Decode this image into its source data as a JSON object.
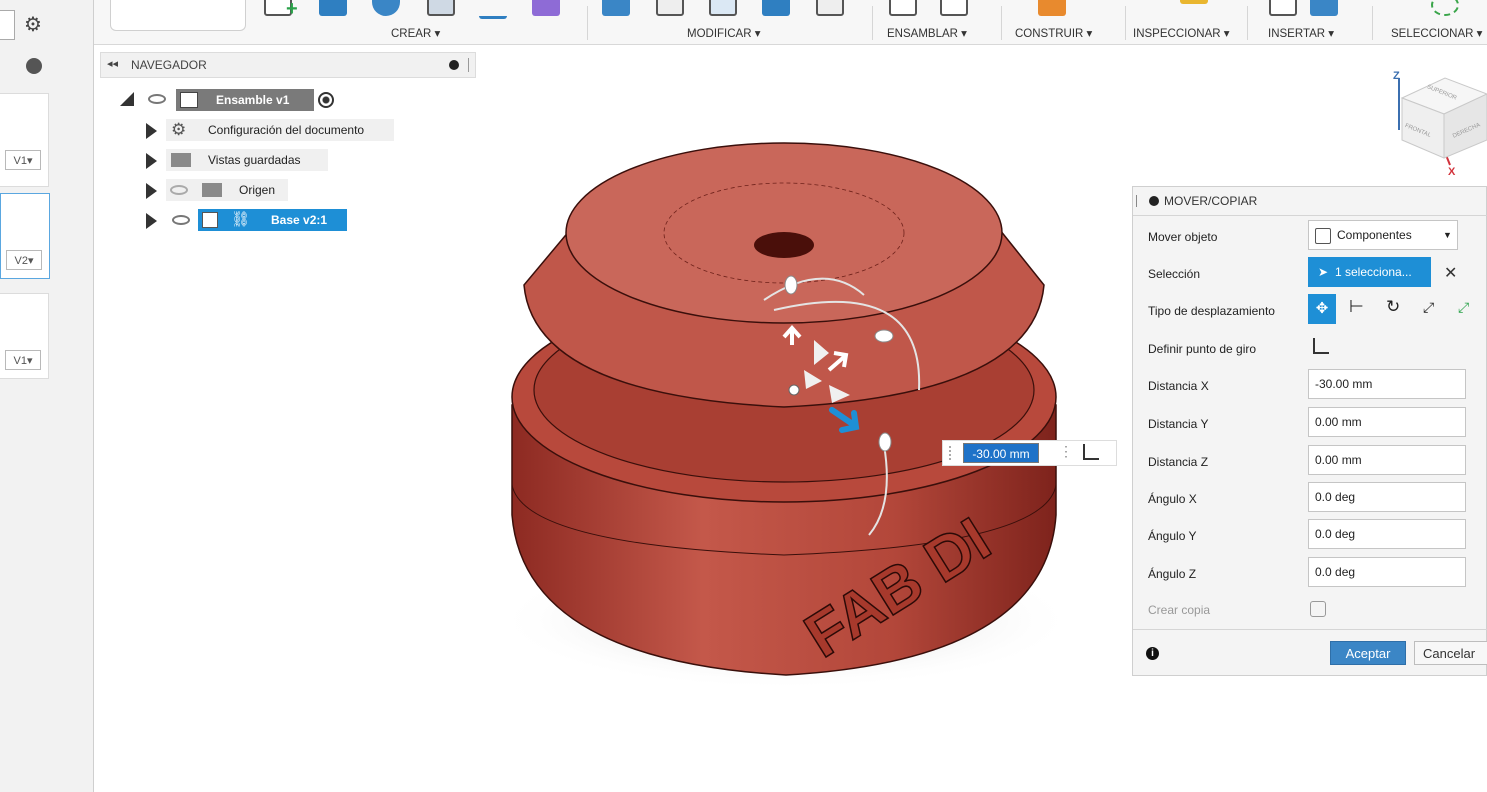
{
  "leftstrip": {
    "versions": [
      "V1▾",
      "V2▾",
      "V1▾"
    ]
  },
  "toolbar": {
    "groups": [
      "CREAR ▾",
      "MODIFICAR ▾",
      "ENSAMBLAR ▾",
      "CONSTRUIR ▾",
      "INSPECCIONAR ▾",
      "INSERTAR ▾",
      "SELECCIONAR ▾"
    ]
  },
  "browser": {
    "title": "NAVEGADOR",
    "root": "Ensamble v1",
    "items": [
      "Configuración del documento",
      "Vistas guardadas",
      "Origen",
      "Base v2:1"
    ]
  },
  "viewcube": {
    "axis_x": "X",
    "axis_z": "Z",
    "face_top": "SUPERIOR",
    "face_front": "FRONTAL",
    "face_right": "DERECHA"
  },
  "viewport": {
    "model_text": "FAB DI",
    "inline_value": "-30.00 mm",
    "colors": {
      "body": "#b5473a",
      "selection": "#1e8fd6"
    }
  },
  "dialog": {
    "title": "MOVER/COPIAR",
    "rows": {
      "mover_objeto": {
        "label": "Mover objeto",
        "value": "Componentes"
      },
      "seleccion": {
        "label": "Selección",
        "value": "1 selecciona..."
      },
      "tipo": {
        "label": "Tipo de desplazamiento"
      },
      "pivote": {
        "label": "Definir punto de giro"
      },
      "dx": {
        "label": "Distancia X",
        "value": "-30.00 mm"
      },
      "dy": {
        "label": "Distancia Y",
        "value": "0.00 mm"
      },
      "dz": {
        "label": "Distancia Z",
        "value": "0.00 mm"
      },
      "ax": {
        "label": "Ángulo X",
        "value": "0.0 deg"
      },
      "ay": {
        "label": "Ángulo Y",
        "value": "0.0 deg"
      },
      "az": {
        "label": "Ángulo Z",
        "value": "0.0 deg"
      },
      "copia": {
        "label": "Crear copia"
      }
    },
    "accept": "Aceptar",
    "cancel": "Cancelar"
  }
}
